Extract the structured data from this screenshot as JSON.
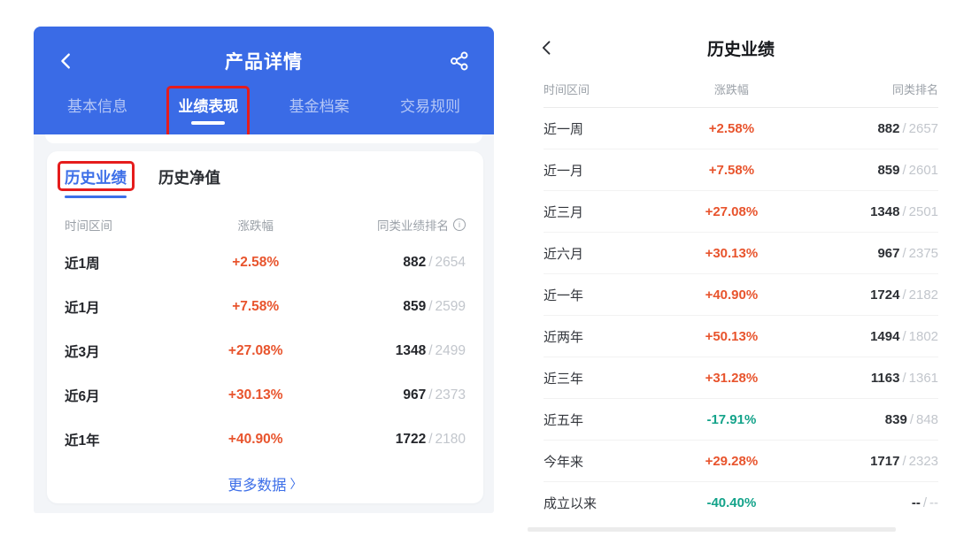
{
  "colors": {
    "header_blue": "#3a6be6",
    "accent_blue": "#3d6fe8",
    "positive_orange": "#e8542d",
    "negative_teal": "#14a38a",
    "annotation_red": "#e51c1c"
  },
  "icons": {
    "back": "chevron-left-icon",
    "share": "share-icon",
    "info": "info-icon",
    "more": "chevron-right-icon"
  },
  "left_screen": {
    "nav": {
      "title": "产品详情"
    },
    "tabs": [
      {
        "label": "基本信息",
        "active": false,
        "annotated": false
      },
      {
        "label": "业绩表现",
        "active": true,
        "annotated": true
      },
      {
        "label": "基金档案",
        "active": false,
        "annotated": false
      },
      {
        "label": "交易规则",
        "active": false,
        "annotated": false
      }
    ],
    "subtabs": [
      {
        "label": "历史业绩",
        "active": true,
        "annotated": true
      },
      {
        "label": "历史净值",
        "active": false,
        "annotated": false
      }
    ],
    "table": {
      "columns": {
        "period": "时间区间",
        "change": "涨跌幅",
        "rank": "同类业绩排名"
      },
      "rank_separator": "/",
      "rows": [
        {
          "period": "近1周",
          "change": "+2.58%",
          "rank": "882",
          "total": "2654"
        },
        {
          "period": "近1月",
          "change": "+7.58%",
          "rank": "859",
          "total": "2599"
        },
        {
          "period": "近3月",
          "change": "+27.08%",
          "rank": "1348",
          "total": "2499"
        },
        {
          "period": "近6月",
          "change": "+30.13%",
          "rank": "967",
          "total": "2373"
        },
        {
          "period": "近1年",
          "change": "+40.90%",
          "rank": "1722",
          "total": "2180"
        }
      ]
    },
    "more_label": "更多数据",
    "more_chevron": "〉"
  },
  "right_screen": {
    "nav": {
      "title": "历史业绩"
    },
    "table": {
      "columns": {
        "period": "时间区间",
        "change": "涨跌幅",
        "rank": "同类排名"
      },
      "rank_separator": "/",
      "rows": [
        {
          "period": "近一周",
          "change": "+2.58%",
          "rank": "882",
          "total": "2657"
        },
        {
          "period": "近一月",
          "change": "+7.58%",
          "rank": "859",
          "total": "2601"
        },
        {
          "period": "近三月",
          "change": "+27.08%",
          "rank": "1348",
          "total": "2501"
        },
        {
          "period": "近六月",
          "change": "+30.13%",
          "rank": "967",
          "total": "2375"
        },
        {
          "period": "近一年",
          "change": "+40.90%",
          "rank": "1724",
          "total": "2182"
        },
        {
          "period": "近两年",
          "change": "+50.13%",
          "rank": "1494",
          "total": "1802"
        },
        {
          "period": "近三年",
          "change": "+31.28%",
          "rank": "1163",
          "total": "1361"
        },
        {
          "period": "近五年",
          "change": "-17.91%",
          "rank": "839",
          "total": "848"
        },
        {
          "period": "今年来",
          "change": "+29.28%",
          "rank": "1717",
          "total": "2323"
        },
        {
          "period": "成立以来",
          "change": "-40.40%",
          "rank": "--",
          "total": "--"
        }
      ]
    }
  }
}
